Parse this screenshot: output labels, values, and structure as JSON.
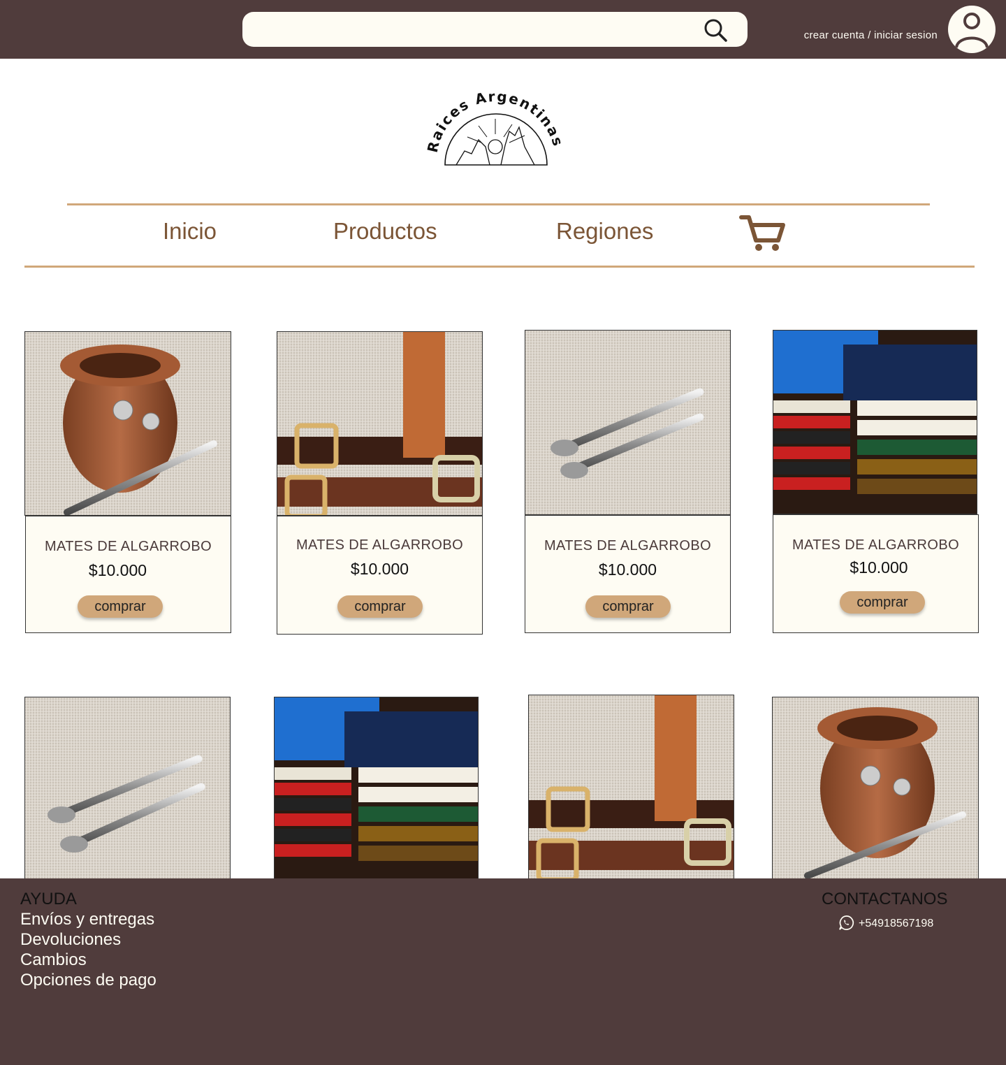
{
  "header": {
    "search_placeholder": "",
    "account_link": "crear cuenta / iniciar sesion"
  },
  "logo": {
    "text": "Raices Argentinas"
  },
  "nav": {
    "items": [
      "Inicio",
      "Productos",
      "Regiones"
    ]
  },
  "products": [
    {
      "name": "MATES DE ALGARROBO",
      "price": "$10.000",
      "button": "comprar",
      "image": "mate"
    },
    {
      "name": "MATES DE ALGARROBO",
      "price": "$10.000",
      "button": "comprar",
      "image": "belts"
    },
    {
      "name": "MATES DE ALGARROBO",
      "price": "$10.000",
      "button": "comprar",
      "image": "bombillas"
    },
    {
      "name": "MATES DE ALGARROBO",
      "price": "$10.000",
      "button": "comprar",
      "image": "textiles"
    },
    {
      "image": "bombillas"
    },
    {
      "image": "textiles"
    },
    {
      "image": "belts"
    },
    {
      "image": "mate"
    }
  ],
  "footer": {
    "help_title": "AYUDA",
    "help_links": [
      "Envíos y entregas",
      "Devoluciones",
      "Cambios",
      "Opciones de pago"
    ],
    "contact_title": "CONTACTANOS",
    "phone": "+54918567198"
  },
  "colors": {
    "header_bg": "#503c3c",
    "accent": "#d0a77a",
    "nav_text": "#7b5536",
    "card_bg": "#fefcf3"
  }
}
